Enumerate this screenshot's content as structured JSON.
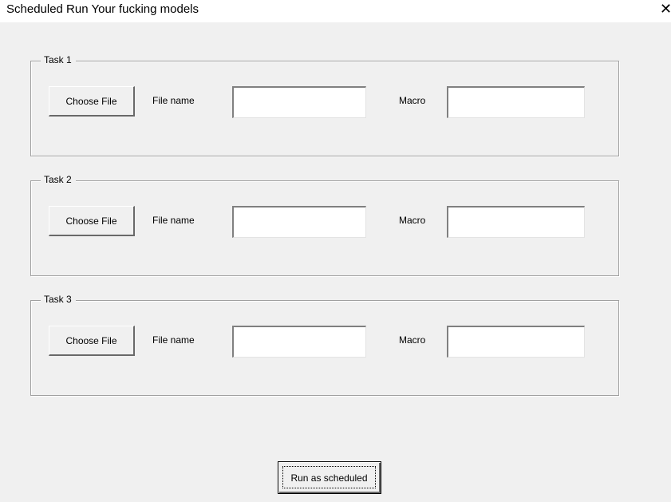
{
  "window": {
    "title": "Scheduled Run Your fucking models",
    "close_glyph": "✕"
  },
  "tasks": [
    {
      "legend": "Task 1",
      "choose_label": "Choose File",
      "filename_label": "File name",
      "filename_value": "",
      "macro_label": "Macro",
      "macro_value": ""
    },
    {
      "legend": "Task 2",
      "choose_label": "Choose File",
      "filename_label": "File name",
      "filename_value": "",
      "macro_label": "Macro",
      "macro_value": ""
    },
    {
      "legend": "Task 3",
      "choose_label": "Choose File",
      "filename_label": "File name",
      "filename_value": "",
      "macro_label": "Macro",
      "macro_value": ""
    }
  ],
  "footer": {
    "run_label": "Run as scheduled"
  }
}
